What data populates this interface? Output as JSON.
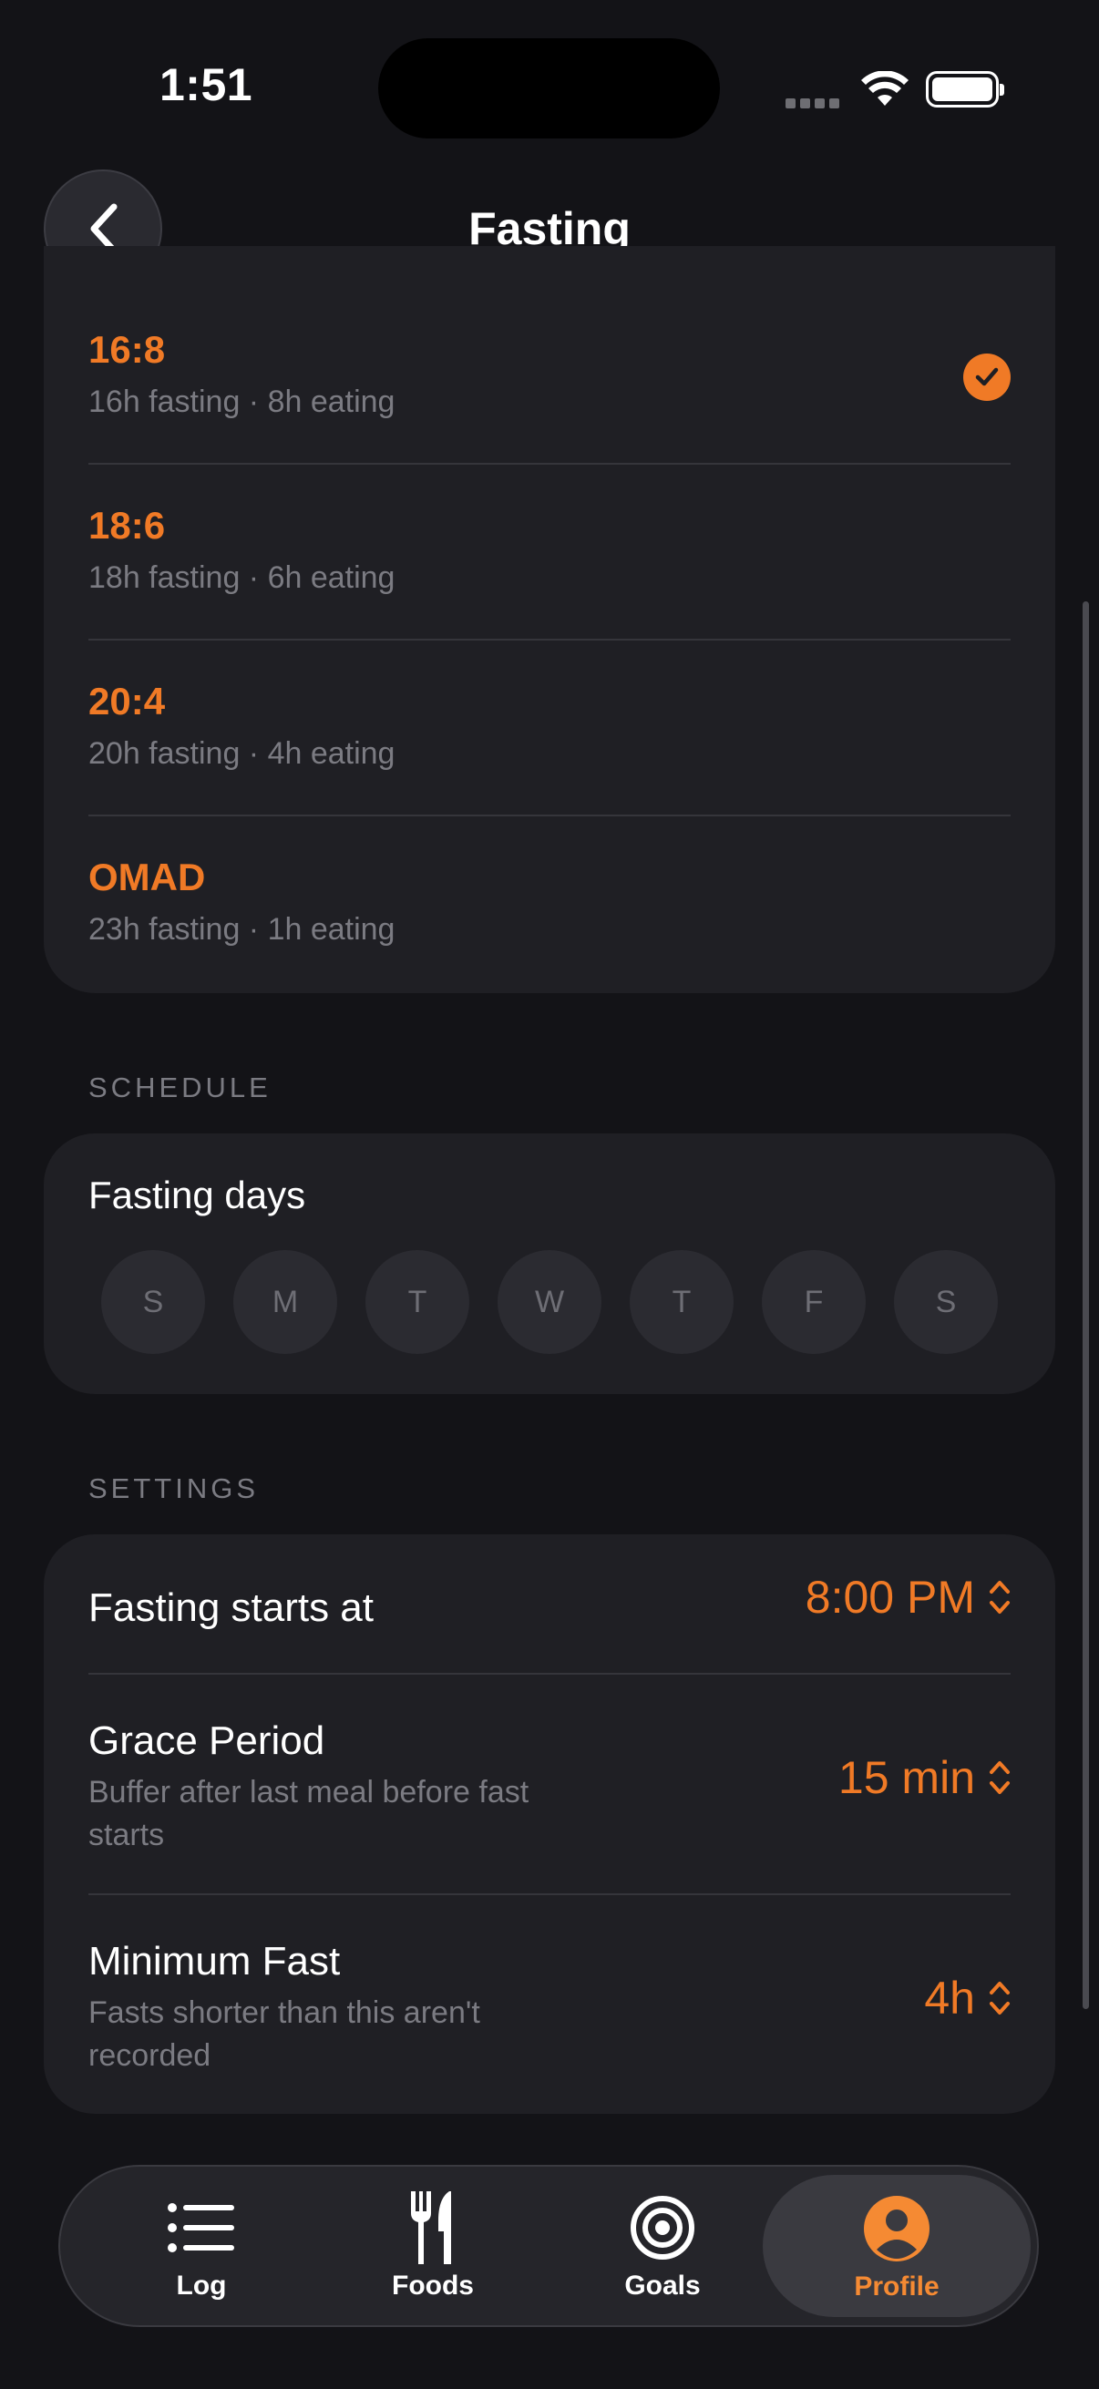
{
  "status": {
    "time": "1:51"
  },
  "nav": {
    "title": "Fasting"
  },
  "plans": [
    {
      "name": "16:8",
      "desc": "16h fasting · 8h eating",
      "selected": true
    },
    {
      "name": "18:6",
      "desc": "18h fasting · 6h eating",
      "selected": false
    },
    {
      "name": "20:4",
      "desc": "20h fasting · 4h eating",
      "selected": false
    },
    {
      "name": "OMAD",
      "desc": "23h fasting · 1h eating",
      "selected": false
    }
  ],
  "schedule": {
    "section": "SCHEDULE",
    "title": "Fasting days",
    "days": [
      "S",
      "M",
      "T",
      "W",
      "T",
      "F",
      "S"
    ]
  },
  "settings": {
    "section": "SETTINGS",
    "start": {
      "title": "Fasting starts at",
      "value": "8:00 PM"
    },
    "grace": {
      "title": "Grace Period",
      "sub": "Buffer after last meal before fast starts",
      "value": "15 min"
    },
    "minimum": {
      "title": "Minimum Fast",
      "sub": "Fasts shorter than this aren't recorded",
      "value": "4h"
    }
  },
  "tabs": [
    {
      "label": "Log",
      "icon": "list-icon"
    },
    {
      "label": "Foods",
      "icon": "fork-knife-icon"
    },
    {
      "label": "Goals",
      "icon": "target-icon"
    },
    {
      "label": "Profile",
      "icon": "person-icon",
      "active": true
    }
  ],
  "colors": {
    "accent": "#f07a26",
    "background": "#131317",
    "card": "#1f1f24"
  }
}
